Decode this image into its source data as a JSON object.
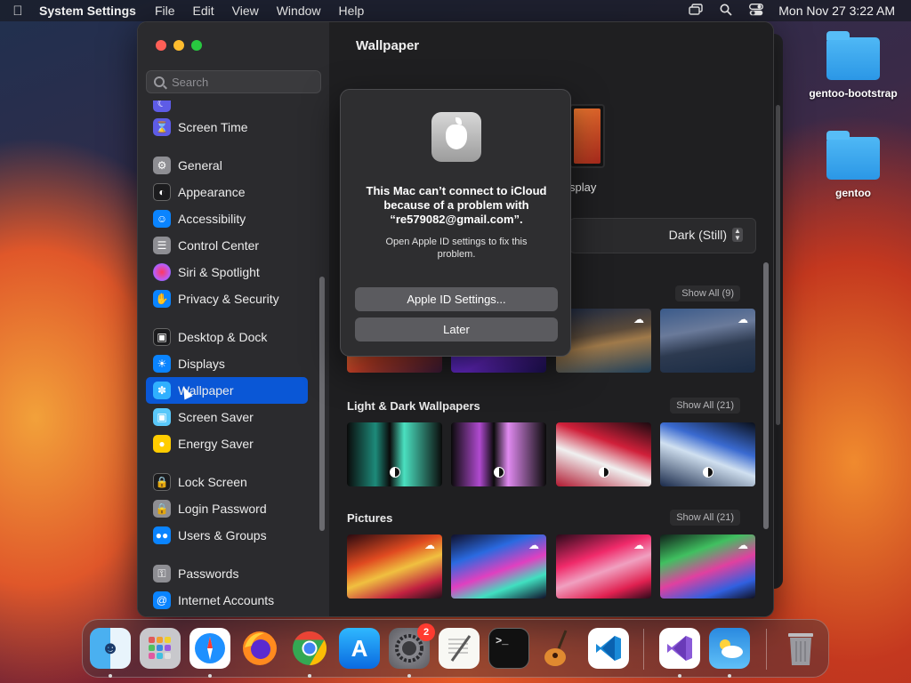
{
  "menubar": {
    "app_name": "System Settings",
    "menus": [
      "File",
      "Edit",
      "View",
      "Window",
      "Help"
    ],
    "clock": "Mon Nov 27  3:22 AM"
  },
  "desktop": {
    "icons": [
      {
        "label": "gentoo-bootstrap"
      },
      {
        "label": "gentoo"
      }
    ]
  },
  "window": {
    "search_placeholder": "Search",
    "sidebar": {
      "items": [
        {
          "label": "Screen Time",
          "icon": "hourglass-icon",
          "color": "#5e5ce6"
        },
        {
          "label": "General",
          "icon": "gear-icon",
          "color": "#8e8e93"
        },
        {
          "label": "Appearance",
          "icon": "appearance-icon",
          "color": "#1c1c1e"
        },
        {
          "label": "Accessibility",
          "icon": "accessibility-icon",
          "color": "#0a84ff"
        },
        {
          "label": "Control Center",
          "icon": "control-center-icon",
          "color": "#8e8e93"
        },
        {
          "label": "Siri & Spotlight",
          "icon": "siri-icon",
          "color": "#bf5af2"
        },
        {
          "label": "Privacy & Security",
          "icon": "hand-icon",
          "color": "#0a84ff"
        },
        {
          "label": "Desktop & Dock",
          "icon": "dock-icon",
          "color": "#1c1c1e"
        },
        {
          "label": "Displays",
          "icon": "sun-icon",
          "color": "#0a84ff"
        },
        {
          "label": "Wallpaper",
          "icon": "wallpaper-icon",
          "color": "#30b0ff"
        },
        {
          "label": "Screen Saver",
          "icon": "screen-saver-icon",
          "color": "#5ac8fa"
        },
        {
          "label": "Energy Saver",
          "icon": "bulb-icon",
          "color": "#ffcc00"
        },
        {
          "label": "Lock Screen",
          "icon": "lock-icon",
          "color": "#1c1c1e"
        },
        {
          "label": "Login Password",
          "icon": "lock-icon",
          "color": "#8e8e93"
        },
        {
          "label": "Users & Groups",
          "icon": "users-icon",
          "color": "#0a84ff"
        },
        {
          "label": "Passwords",
          "icon": "key-icon",
          "color": "#8e8e93"
        },
        {
          "label": "Internet Accounts",
          "icon": "at-icon",
          "color": "#0a84ff"
        }
      ],
      "active": "Wallpaper"
    },
    "main": {
      "title": "Wallpaper",
      "display_label": "splay",
      "appearance_mode": "Dark (Still)",
      "sections": [
        {
          "title": "",
          "show_all": "Show All (9)"
        },
        {
          "title": "Light & Dark Wallpapers",
          "show_all": "Show All (21)"
        },
        {
          "title": "Pictures",
          "show_all": "Show All (21)"
        }
      ]
    }
  },
  "alert": {
    "title": "This Mac can’t connect to iCloud because of a problem with “re579082@gmail.com”.",
    "message": "Open Apple ID settings to fix this problem.",
    "primary_button": "Apple ID Settings...",
    "secondary_button": "Later"
  },
  "dock": {
    "apps": [
      "Finder",
      "Launchpad",
      "Safari",
      "Firefox",
      "Chrome",
      "App Store",
      "System Settings",
      "TextEdit",
      "Terminal",
      "GarageBand",
      "Visual Studio Code",
      "Visual Studio",
      "Weather",
      "Trash"
    ],
    "settings_badge": "2"
  }
}
